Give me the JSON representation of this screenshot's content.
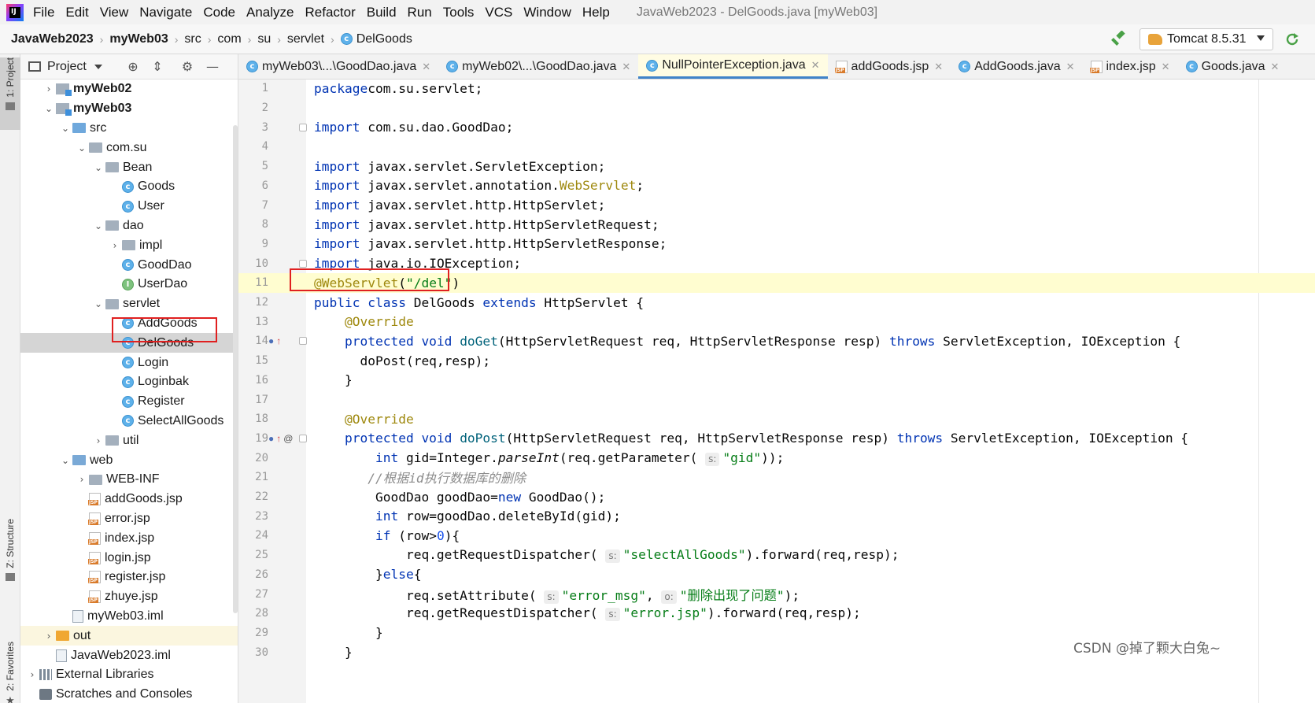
{
  "menubar": {
    "logo": "IJ",
    "items": [
      "File",
      "Edit",
      "View",
      "Navigate",
      "Code",
      "Analyze",
      "Refactor",
      "Build",
      "Run",
      "Tools",
      "VCS",
      "Window",
      "Help"
    ],
    "window_title": "JavaWeb2023 - DelGoods.java [myWeb03]"
  },
  "navbar": {
    "breadcrumbs": [
      "JavaWeb2023",
      "myWeb03",
      "src",
      "com",
      "su",
      "servlet",
      "DelGoods"
    ],
    "run_config": "Tomcat 8.5.31",
    "icons": [
      "build-hammer-icon",
      "rerun-icon"
    ]
  },
  "tool_strip": {
    "project_tab": "1: Project",
    "structure_tab": "Z: Structure",
    "favorites_tab": "2: Favorites"
  },
  "project_panel": {
    "title": "Project",
    "icons": [
      "locate-icon",
      "collapse-icon",
      "gear-icon",
      "minimize-icon"
    ],
    "tree": [
      {
        "label": "myWeb02",
        "indent": 1,
        "toggle": "collapsed",
        "icon": "module",
        "bold": true
      },
      {
        "label": "myWeb03",
        "indent": 1,
        "toggle": "expanded",
        "icon": "module",
        "bold": true
      },
      {
        "label": "src",
        "indent": 2,
        "toggle": "expanded",
        "icon": "folder-src"
      },
      {
        "label": "com.su",
        "indent": 3,
        "toggle": "expanded",
        "icon": "package"
      },
      {
        "label": "Bean",
        "indent": 4,
        "toggle": "expanded",
        "icon": "package"
      },
      {
        "label": "Goods",
        "indent": 5,
        "toggle": "none",
        "icon": "class"
      },
      {
        "label": "User",
        "indent": 5,
        "toggle": "none",
        "icon": "class"
      },
      {
        "label": "dao",
        "indent": 4,
        "toggle": "expanded",
        "icon": "package"
      },
      {
        "label": "impl",
        "indent": 5,
        "toggle": "collapsed",
        "icon": "package"
      },
      {
        "label": "GoodDao",
        "indent": 5,
        "toggle": "none",
        "icon": "class"
      },
      {
        "label": "UserDao",
        "indent": 5,
        "toggle": "none",
        "icon": "interface"
      },
      {
        "label": "servlet",
        "indent": 4,
        "toggle": "expanded",
        "icon": "package"
      },
      {
        "label": "AddGoods",
        "indent": 5,
        "toggle": "none",
        "icon": "class"
      },
      {
        "label": "DelGoods",
        "indent": 5,
        "toggle": "none",
        "icon": "class",
        "selected": true
      },
      {
        "label": "Login",
        "indent": 5,
        "toggle": "none",
        "icon": "class"
      },
      {
        "label": "Loginbak",
        "indent": 5,
        "toggle": "none",
        "icon": "class"
      },
      {
        "label": "Register",
        "indent": 5,
        "toggle": "none",
        "icon": "class"
      },
      {
        "label": "SelectAllGoods",
        "indent": 5,
        "toggle": "none",
        "icon": "class"
      },
      {
        "label": "util",
        "indent": 4,
        "toggle": "collapsed",
        "icon": "package"
      },
      {
        "label": "web",
        "indent": 2,
        "toggle": "expanded",
        "icon": "folder-web"
      },
      {
        "label": "WEB-INF",
        "indent": 3,
        "toggle": "collapsed",
        "icon": "folder"
      },
      {
        "label": "addGoods.jsp",
        "indent": 3,
        "toggle": "none",
        "icon": "jsp"
      },
      {
        "label": "error.jsp",
        "indent": 3,
        "toggle": "none",
        "icon": "jsp"
      },
      {
        "label": "index.jsp",
        "indent": 3,
        "toggle": "none",
        "icon": "jsp"
      },
      {
        "label": "login.jsp",
        "indent": 3,
        "toggle": "none",
        "icon": "jsp"
      },
      {
        "label": "register.jsp",
        "indent": 3,
        "toggle": "none",
        "icon": "jsp"
      },
      {
        "label": "zhuye.jsp",
        "indent": 3,
        "toggle": "none",
        "icon": "jsp"
      },
      {
        "label": "myWeb03.iml",
        "indent": 2,
        "toggle": "none",
        "icon": "iml"
      },
      {
        "label": "out",
        "indent": 1,
        "toggle": "collapsed",
        "icon": "folder-out",
        "highlight": true
      },
      {
        "label": "JavaWeb2023.iml",
        "indent": 1,
        "toggle": "none",
        "icon": "iml"
      },
      {
        "label": "External Libraries",
        "indent": 0,
        "toggle": "collapsed",
        "icon": "libs"
      },
      {
        "label": "Scratches and Consoles",
        "indent": 0,
        "toggle": "none",
        "icon": "scratch"
      }
    ]
  },
  "editor_tabs": [
    {
      "label": "myWeb03\\...\\GoodDao.java",
      "icon": "class",
      "active": false
    },
    {
      "label": "myWeb02\\...\\GoodDao.java",
      "icon": "class",
      "active": false
    },
    {
      "label": "NullPointerException.java",
      "icon": "class",
      "active": true
    },
    {
      "label": "addGoods.jsp",
      "icon": "jsp",
      "active": false
    },
    {
      "label": "AddGoods.java",
      "icon": "class",
      "active": false
    },
    {
      "label": "index.jsp",
      "icon": "jsp",
      "active": false
    },
    {
      "label": "Goods.java",
      "icon": "class",
      "active": false
    }
  ],
  "editor": {
    "caret_line": 11,
    "lines": [
      {
        "n": 1,
        "tokens": [
          [
            "kw",
            "package"
          ],
          [
            "",
            "com.su.servlet;"
          ]
        ]
      },
      {
        "n": 2,
        "tokens": []
      },
      {
        "n": 3,
        "fold": true,
        "tokens": [
          [
            "kw",
            "import"
          ],
          [
            "",
            " com.su.dao.GoodDao;"
          ]
        ]
      },
      {
        "n": 4,
        "tokens": []
      },
      {
        "n": 5,
        "tokens": [
          [
            "kw",
            "import"
          ],
          [
            "",
            " javax.servlet.ServletException;"
          ]
        ]
      },
      {
        "n": 6,
        "tokens": [
          [
            "kw",
            "import"
          ],
          [
            "",
            " javax.servlet.annotation."
          ],
          [
            "an",
            "WebServlet"
          ],
          [
            "",
            ";"
          ]
        ]
      },
      {
        "n": 7,
        "tokens": [
          [
            "kw",
            "import"
          ],
          [
            "",
            " javax.servlet.http.HttpServlet;"
          ]
        ]
      },
      {
        "n": 8,
        "tokens": [
          [
            "kw",
            "import"
          ],
          [
            "",
            " javax.servlet.http.HttpServletRequest;"
          ]
        ]
      },
      {
        "n": 9,
        "tokens": [
          [
            "kw",
            "import"
          ],
          [
            "",
            " javax.servlet.http.HttpServletResponse;"
          ]
        ]
      },
      {
        "n": 10,
        "fold": true,
        "tokens": [
          [
            "kw",
            "import"
          ],
          [
            "",
            " java.io.IOException;"
          ]
        ]
      },
      {
        "n": 11,
        "tokens": [
          [
            "an",
            "@WebServlet"
          ],
          [
            "",
            "("
          ],
          [
            "str",
            "\"/del\""
          ],
          [
            "",
            ")"
          ]
        ]
      },
      {
        "n": 12,
        "tokens": [
          [
            "kw",
            "public class"
          ],
          [
            "",
            " DelGoods "
          ],
          [
            "kw",
            "extends"
          ],
          [
            "",
            " HttpServlet {"
          ]
        ]
      },
      {
        "n": 13,
        "tokens": [
          [
            "",
            "    "
          ],
          [
            "an",
            "@Override"
          ]
        ]
      },
      {
        "n": 14,
        "marker": "override",
        "fold": true,
        "tokens": [
          [
            "",
            "    "
          ],
          [
            "kw",
            "protected void"
          ],
          [
            "",
            " "
          ],
          [
            "fn",
            "doGet"
          ],
          [
            "",
            "(HttpServletRequest req, HttpServletResponse resp) "
          ],
          [
            "kw",
            "throws"
          ],
          [
            "",
            " ServletException, IOException {"
          ]
        ]
      },
      {
        "n": 15,
        "tokens": [
          [
            "",
            "      doPost(req,resp);"
          ]
        ]
      },
      {
        "n": 16,
        "tokens": [
          [
            "",
            "    }"
          ]
        ]
      },
      {
        "n": 17,
        "tokens": []
      },
      {
        "n": 18,
        "tokens": [
          [
            "",
            "    "
          ],
          [
            "an",
            "@Override"
          ]
        ]
      },
      {
        "n": 19,
        "marker": "override-at",
        "fold": true,
        "tokens": [
          [
            "",
            "    "
          ],
          [
            "kw",
            "protected void"
          ],
          [
            "",
            " "
          ],
          [
            "fn",
            "doPost"
          ],
          [
            "",
            "(HttpServletRequest req, HttpServletResponse resp) "
          ],
          [
            "kw",
            "throws"
          ],
          [
            "",
            " ServletException, IOException {"
          ]
        ]
      },
      {
        "n": 20,
        "tokens": [
          [
            "",
            "        "
          ],
          [
            "kw",
            "int"
          ],
          [
            "",
            " gid=Integer."
          ],
          [
            "it",
            "parseInt"
          ],
          [
            "",
            "(req.getParameter( "
          ],
          [
            "hint",
            "s:"
          ],
          [
            "str",
            "\"gid\""
          ],
          [
            "",
            "));"
          ]
        ]
      },
      {
        "n": 21,
        "tokens": [
          [
            "",
            "       "
          ],
          [
            "cm",
            "//根据id执行数据库的删除"
          ]
        ]
      },
      {
        "n": 22,
        "tokens": [
          [
            "",
            "        GoodDao goodDao="
          ],
          [
            "kw",
            "new"
          ],
          [
            "",
            " GoodDao();"
          ]
        ]
      },
      {
        "n": 23,
        "tokens": [
          [
            "",
            "        "
          ],
          [
            "kw",
            "int"
          ],
          [
            "",
            " row=goodDao.deleteById(gid);"
          ]
        ]
      },
      {
        "n": 24,
        "tokens": [
          [
            "",
            "        "
          ],
          [
            "kw",
            "if"
          ],
          [
            "",
            " (row>"
          ],
          [
            "num",
            "0"
          ],
          [
            "",
            "){"
          ]
        ]
      },
      {
        "n": 25,
        "tokens": [
          [
            "",
            "            req.getRequestDispatcher( "
          ],
          [
            "hint",
            "s:"
          ],
          [
            "str",
            "\"selectAllGoods\""
          ],
          [
            "",
            ").forward(req,resp);"
          ]
        ]
      },
      {
        "n": 26,
        "tokens": [
          [
            "",
            "        }"
          ],
          [
            "kw",
            "else"
          ],
          [
            "",
            "{"
          ]
        ]
      },
      {
        "n": 27,
        "tokens": [
          [
            "",
            "            req.setAttribute( "
          ],
          [
            "hint",
            "s:"
          ],
          [
            "str",
            "\"error_msg\""
          ],
          [
            "",
            ", "
          ],
          [
            "hint",
            "o:"
          ],
          [
            "str",
            "\"删除出现了问题\""
          ],
          [
            "",
            ");"
          ]
        ]
      },
      {
        "n": 28,
        "tokens": [
          [
            "",
            "            req.getRequestDispatcher( "
          ],
          [
            "hint",
            "s:"
          ],
          [
            "str",
            "\"error.jsp\""
          ],
          [
            "",
            ").forward(req,resp);"
          ]
        ]
      },
      {
        "n": 29,
        "tokens": [
          [
            "",
            "        }"
          ]
        ]
      },
      {
        "n": 30,
        "tokens": [
          [
            "",
            "    }"
          ]
        ]
      }
    ]
  },
  "watermark": "CSDN @掉了颗大白兔~",
  "colors": {
    "keyword": "#0033b3",
    "annotation": "#9e880d",
    "string": "#067d17",
    "highlight_box": "#e02020"
  }
}
